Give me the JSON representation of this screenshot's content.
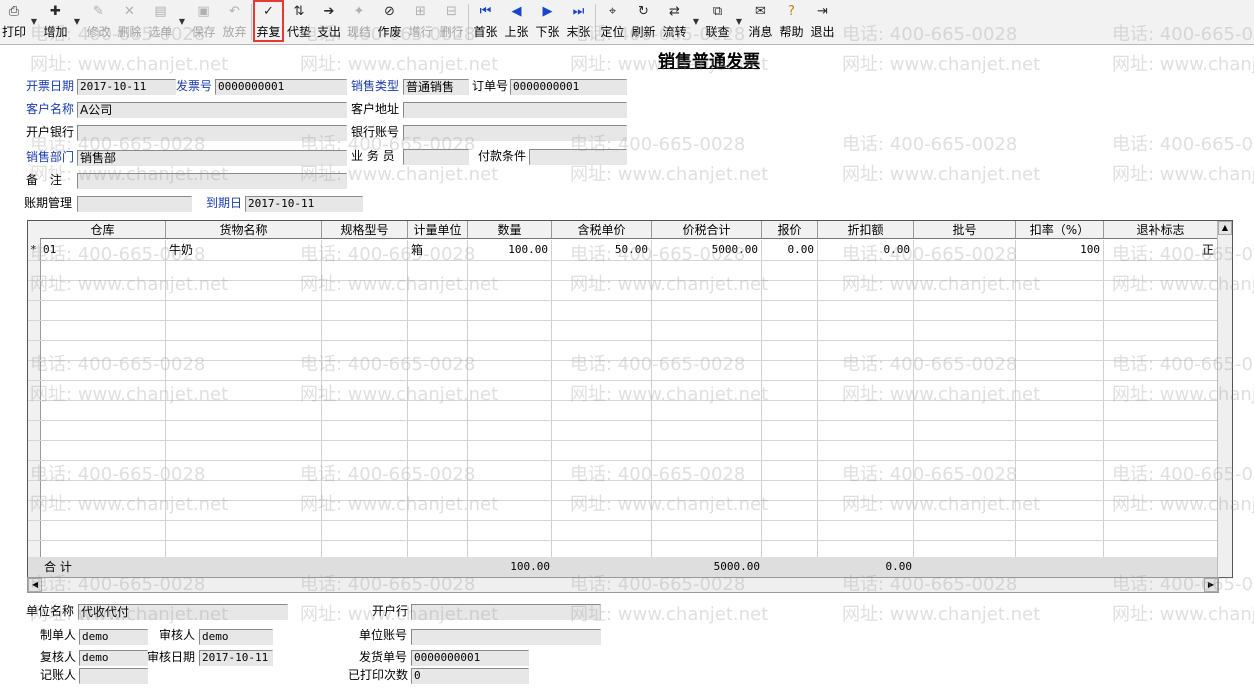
{
  "toolbar": {
    "buttons": [
      {
        "label": "打印",
        "icon": "printer-icon",
        "enabled": true
      },
      {
        "label": "增加",
        "icon": "add-doc-icon",
        "enabled": true
      },
      {
        "label": "修改",
        "icon": "edit-icon",
        "enabled": false
      },
      {
        "label": "删除",
        "icon": "delete-icon",
        "enabled": false
      },
      {
        "label": "选单",
        "icon": "select-doc-icon",
        "enabled": false
      },
      {
        "label": "保存",
        "icon": "save-icon",
        "enabled": false
      },
      {
        "label": "放弃",
        "icon": "undo-icon",
        "enabled": false
      },
      {
        "label": "弃复",
        "icon": "abandon-restore-icon",
        "enabled": true,
        "highlighted": true
      },
      {
        "label": "代垫",
        "icon": "advance-icon",
        "enabled": true
      },
      {
        "label": "支出",
        "icon": "expense-icon",
        "enabled": true
      },
      {
        "label": "现结",
        "icon": "cash-settle-icon",
        "enabled": false
      },
      {
        "label": "作废",
        "icon": "void-icon",
        "enabled": true
      },
      {
        "label": "增行",
        "icon": "add-row-icon",
        "enabled": false
      },
      {
        "label": "删行",
        "icon": "delete-row-icon",
        "enabled": false
      },
      {
        "label": "首张",
        "icon": "first-record-icon",
        "enabled": true
      },
      {
        "label": "上张",
        "icon": "previous-record-icon",
        "enabled": true
      },
      {
        "label": "下张",
        "icon": "next-record-icon",
        "enabled": true
      },
      {
        "label": "末张",
        "icon": "last-record-icon",
        "enabled": true
      },
      {
        "label": "定位",
        "icon": "locate-icon",
        "enabled": true
      },
      {
        "label": "刷新",
        "icon": "refresh-icon",
        "enabled": true
      },
      {
        "label": "流转",
        "icon": "flow-icon",
        "enabled": true
      },
      {
        "label": "联查",
        "icon": "linked-query-icon",
        "enabled": true
      },
      {
        "label": "消息",
        "icon": "message-icon",
        "enabled": true
      },
      {
        "label": "帮助",
        "icon": "help-icon",
        "enabled": true
      },
      {
        "label": "退出",
        "icon": "exit-icon",
        "enabled": true
      }
    ]
  },
  "title": "销售普通发票",
  "header": {
    "invoice_date_label": "开票日期",
    "invoice_date": "2017-10-11",
    "invoice_no_label": "发票号",
    "invoice_no": "0000000001",
    "sales_type_label": "销售类型",
    "sales_type": "普通销售",
    "order_no_label": "订单号",
    "order_no": "0000000001",
    "customer_label": "客户名称",
    "customer": "A公司",
    "customer_addr_label": "客户地址",
    "customer_addr": "",
    "bank_label": "开户银行",
    "bank": "",
    "bank_account_label": "银行账号",
    "bank_account": "",
    "dept_label": "销售部门",
    "dept": "销售部",
    "salesman_label": "业 务 员",
    "salesman": "",
    "payment_terms_label": "付款条件",
    "payment_terms": "",
    "remark_label": "备  注",
    "remark": "",
    "account_period_label": "账期管理",
    "account_period": "",
    "due_date_label": "到期日",
    "due_date": "2017-10-11"
  },
  "grid": {
    "columns": [
      "仓库",
      "货物名称",
      "规格型号",
      "计量单位",
      "数量",
      "含税单价",
      "价税合计",
      "报价",
      "折扣额",
      "批号",
      "扣率（%）",
      "退补标志"
    ],
    "rows": [
      {
        "marker": "*",
        "warehouse": "01",
        "goods": "牛奶",
        "spec": "",
        "unit": "箱",
        "qty": "100.00",
        "unit_price": "50.00",
        "total": "5000.00",
        "quote": "0.00",
        "discount": "0.00",
        "batch": "",
        "rate": "100",
        "flag": "正"
      }
    ],
    "totals": {
      "label": "合  计",
      "qty": "100.00",
      "total": "5000.00",
      "discount": "0.00"
    }
  },
  "footer": {
    "unit_name_label": "单位名称",
    "unit_name": "代收代付",
    "open_bank_label": "开户行",
    "open_bank": "",
    "maker_label": "制单人",
    "maker": "demo",
    "auditor_label": "审核人",
    "auditor": "demo",
    "unit_account_label": "单位账号",
    "unit_account": "",
    "rechecker_label": "复核人",
    "rechecker": "demo",
    "audit_date_label": "审核日期",
    "audit_date": "2017-10-11",
    "delivery_no_label": "发货单号",
    "delivery_no": "0000000001",
    "bookkeeper_label": "记账人",
    "bookkeeper": "",
    "printed_times_label": "已打印次数",
    "printed_times": "0"
  },
  "watermark": {
    "phone": "电话: 400-665-0028",
    "site": "网址: www.chanjet.net"
  }
}
